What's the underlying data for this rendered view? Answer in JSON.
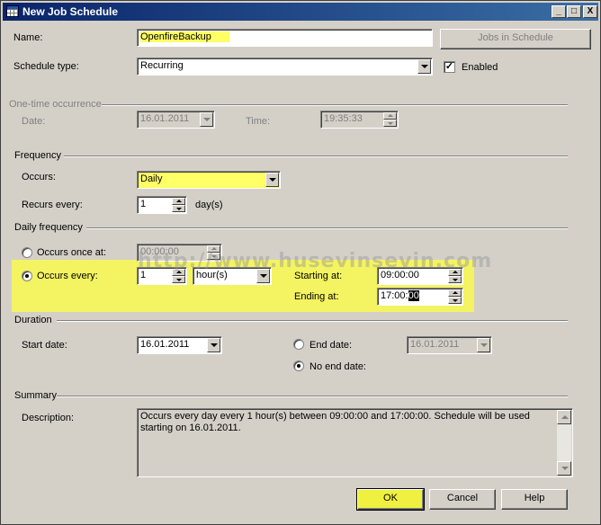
{
  "window": {
    "title": "New Job Schedule",
    "minimize": "_",
    "maximize": "□",
    "close": "X"
  },
  "general": {
    "name_label": "Name:",
    "name_value": "OpenfireBackup",
    "jobs_button": "Jobs in Schedule",
    "schedule_type_label": "Schedule type:",
    "schedule_type_value": "Recurring",
    "enabled_label": "Enabled",
    "enabled_checked": true
  },
  "one_time": {
    "group_label": "One-time occurrence",
    "date_label": "Date:",
    "date_value": "16.01.2011",
    "time_label": "Time:",
    "time_value": "19:35:33"
  },
  "frequency": {
    "group_label": "Frequency",
    "occurs_label": "Occurs:",
    "occurs_value": "Daily",
    "recurs_label": "Recurs every:",
    "recurs_value": "1",
    "recurs_unit": "day(s)"
  },
  "daily_frequency": {
    "group_label": "Daily frequency",
    "once_label": "Occurs once at:",
    "once_value": "00:00:00",
    "every_label": "Occurs every:",
    "every_value": "1",
    "every_unit": "hour(s)",
    "starting_label": "Starting at:",
    "starting_value": "09:00:00",
    "ending_label": "Ending at:",
    "ending_value_prefix": "17:00:",
    "ending_value_selected": "00",
    "selected_option": "every"
  },
  "duration": {
    "group_label": "Duration",
    "start_label": "Start date:",
    "start_value": "16.01.2011",
    "end_label": "End date:",
    "end_value": "16.01.2011",
    "no_end_label": "No end date:",
    "selected_option": "no_end"
  },
  "summary": {
    "group_label": "Summary",
    "description_label": "Description:",
    "description_text": "Occurs every day every 1 hour(s) between 09:00:00 and 17:00:00. Schedule will be used starting on 16.01.2011."
  },
  "buttons": {
    "ok": "OK",
    "cancel": "Cancel",
    "help": "Help"
  },
  "watermark": "http://www.husevinsevin.com",
  "colors": {
    "highlight": "#ffff66",
    "title_bar": "#0a246a",
    "face": "#d4d0c8"
  }
}
